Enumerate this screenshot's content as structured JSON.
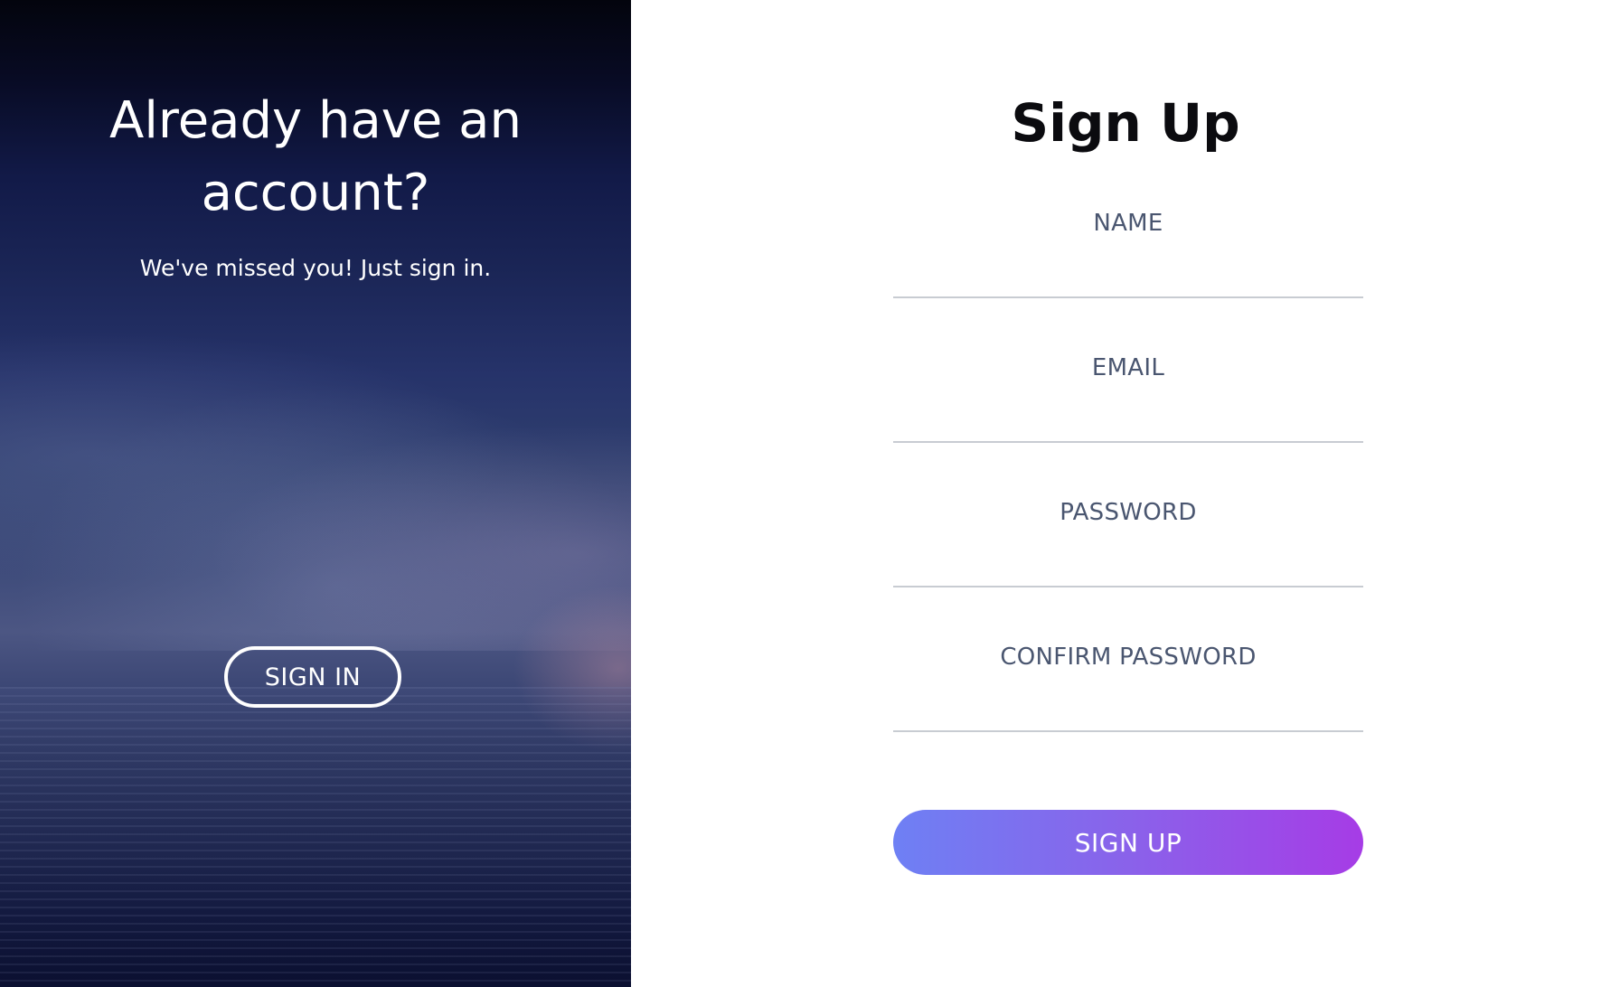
{
  "left_panel": {
    "title_line1": "Already have an",
    "title_line2": "account?",
    "subtitle": "We've missed you! Just sign in.",
    "signin_label": "SIGN IN"
  },
  "form": {
    "title": "Sign Up",
    "fields": [
      {
        "label": "NAME",
        "value": "",
        "type": "text"
      },
      {
        "label": "EMAIL",
        "value": "",
        "type": "email"
      },
      {
        "label": "PASSWORD",
        "value": "",
        "type": "password"
      },
      {
        "label": "CONFIRM PASSWORD",
        "value": "",
        "type": "password"
      }
    ],
    "submit_label": "SIGN UP"
  },
  "colors": {
    "accent_gradient_start": "#6e80f4",
    "accent_gradient_end": "#a63ce6",
    "label_color": "#4a5670",
    "divider_color": "#c8ccd2"
  }
}
